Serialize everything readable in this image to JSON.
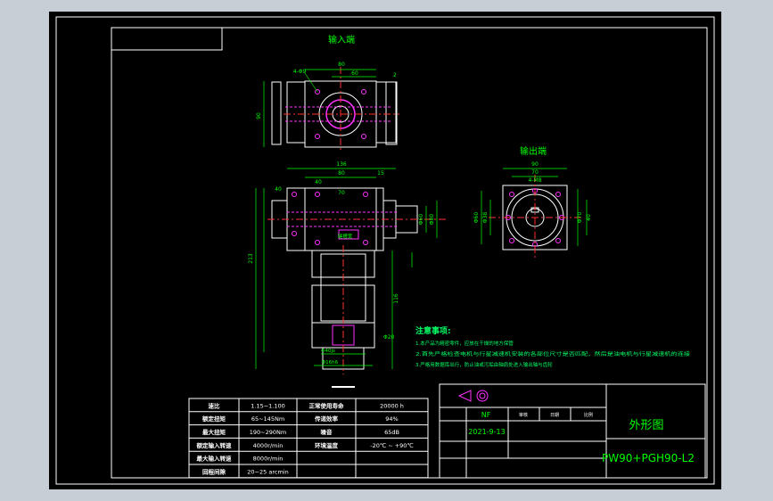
{
  "drawing": {
    "colors": {
      "background": "#000000",
      "outer_bg": "#c8ced6",
      "frame": "#ffffff",
      "part_outline": "#ffffff",
      "hidden_feature": "#ff33ff",
      "dimension": "#00ff00",
      "center_line": "#ff3030",
      "notes_text": "#00ff66",
      "table_text": "#ffffff"
    },
    "views": {
      "input_end_label": "输入端",
      "output_end_label": "输出端"
    },
    "dimensions": {
      "top_view": {
        "width": "80",
        "offset": "60",
        "hole": "4-Φ9",
        "height": "90",
        "small": "2"
      },
      "front_view": {
        "total_width": "136",
        "body_width": "80",
        "right_offset": "15",
        "inner": "40",
        "mid": "70",
        "left_height": "40",
        "total_height": "213",
        "depth": "116",
        "shaft_dia": "Φ20",
        "key": "键槽宽",
        "bottom_dia": "Φ40js",
        "flange": "Φ16h6",
        "right_dims": [
          "Φ60",
          "Φ80"
        ]
      },
      "side_view": {
        "top": "90",
        "inner": "70",
        "hole": "4-M8",
        "left_dims": [
          "Φ60",
          "Φ38"
        ],
        "right_dims": [
          "Φ70",
          "40"
        ]
      }
    },
    "notes": {
      "title": "注意事项:",
      "lines": [
        "1.本产品为精密零件，应放在干燥的地方保管",
        "2.首先严格检查电机与行星减速机安装的各部位尺寸是否匹配，然后是油电机与行星减速机的连接",
        "3.严格用数据库出行，防止油或污垢由轴肩处进入输出轴与齿轮"
      ]
    },
    "spec_table": {
      "rows": [
        [
          "速比",
          "1.15~1.100",
          "正常使用寿命",
          "20000 h"
        ],
        [
          "额定扭矩",
          "65~145Nm",
          "传递效率",
          "94%"
        ],
        [
          "最大扭矩",
          "190~290Nm",
          "噪音",
          "65dB"
        ],
        [
          "额定输入转速",
          "4000r/min",
          "环境温度",
          "-20℃ ~ +90℃"
        ],
        [
          "最大输入转速",
          "8000r/min",
          "",
          ""
        ],
        [
          "回程间隙",
          "20~25 arcmin",
          "",
          ""
        ]
      ]
    },
    "title_block": {
      "drawing_name": "外形图",
      "model": "PW90+PGH90-L2",
      "designer": "NF",
      "date": "2021-9-13",
      "headers": [
        "审核",
        "日期",
        "比例"
      ]
    }
  }
}
